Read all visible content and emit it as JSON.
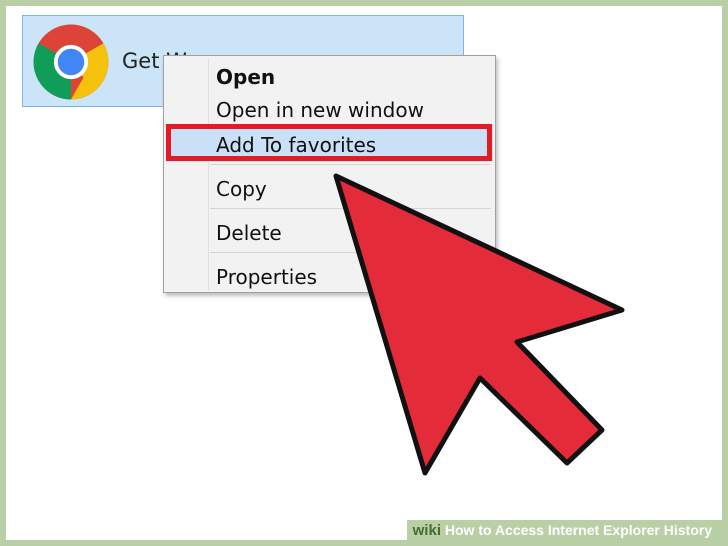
{
  "tile": {
    "label": "Get W",
    "icon": "chrome-icon"
  },
  "context_menu": {
    "items": [
      {
        "label": "Open",
        "bold": true
      },
      {
        "label": "Open in new window"
      },
      {
        "label": "Add To favorites",
        "highlighted": true
      },
      {
        "label": "Copy"
      },
      {
        "label": "Delete"
      },
      {
        "label": "Properties"
      }
    ]
  },
  "annotation": {
    "highlight_color": "#e41b23",
    "arrow_color": "#e32b3a"
  },
  "watermark": {
    "brand": "wiki",
    "title": "How to Access Internet Explorer History"
  }
}
